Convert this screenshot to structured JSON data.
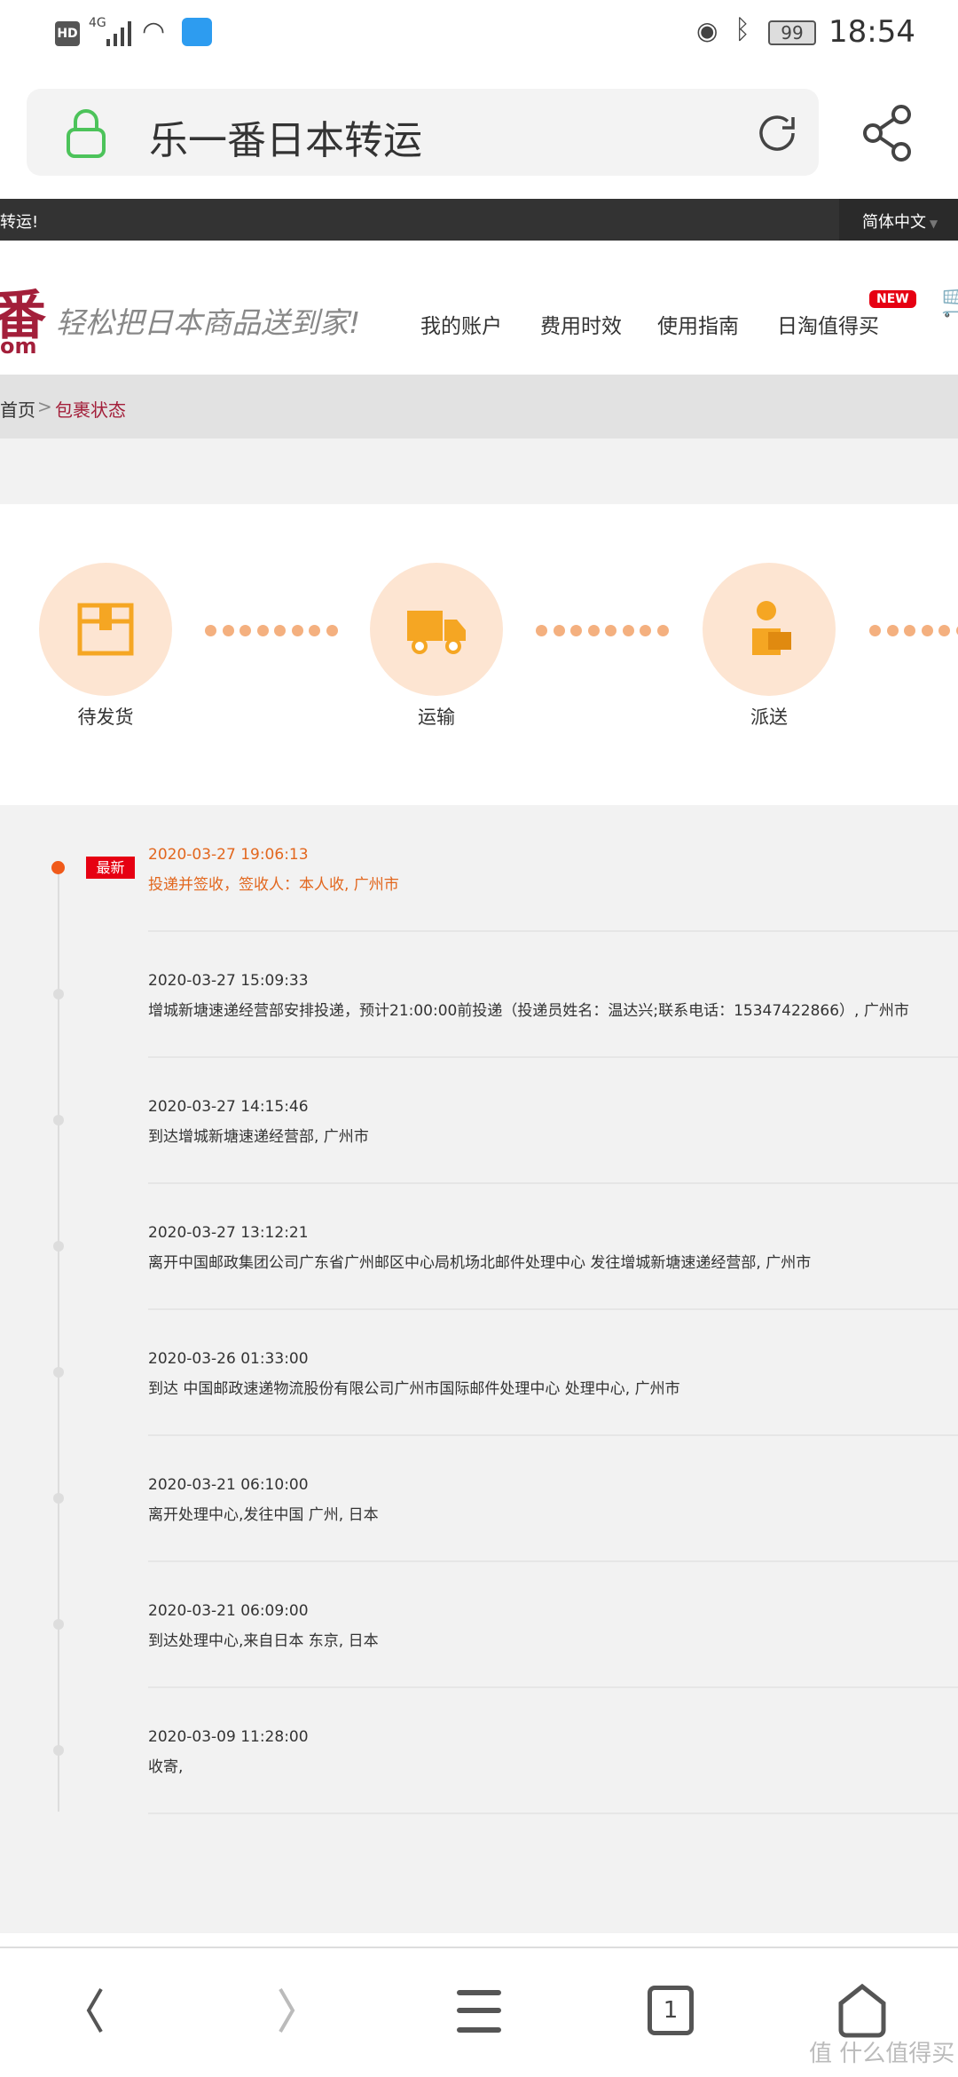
{
  "status_bar": {
    "hd": "HD",
    "network": "4G",
    "battery": "99",
    "time": "18:54"
  },
  "browser": {
    "title": "乐一番日本转运"
  },
  "top_bar": {
    "left_text": "转运!",
    "language": "简体中文"
  },
  "header": {
    "logo_char": "番",
    "logo_suffix": "om",
    "tagline": "轻松把日本商品送到家!",
    "nav": [
      {
        "label": "我的账户"
      },
      {
        "label": "费用时效"
      },
      {
        "label": "使用指南"
      },
      {
        "label": "日淘值得买"
      }
    ],
    "new_badge": "NEW"
  },
  "breadcrumb": {
    "home": "首页",
    "sep": ">",
    "current": "包裹状态"
  },
  "steps": [
    {
      "label": "待发货",
      "icon": "box-icon"
    },
    {
      "label": "运输",
      "icon": "truck-icon"
    },
    {
      "label": "派送",
      "icon": "courier-icon"
    }
  ],
  "colors": {
    "accent": "#e2671e",
    "badge": "#e60012",
    "step_bg": "#fde5d2",
    "step_icon": "#f5a623",
    "brand": "#a31f3a"
  },
  "timeline": {
    "latest_badge": "最新",
    "events": [
      {
        "time": "2020-03-27 19:06:13",
        "desc": "投递并签收，签收人：本人收, 广州市"
      },
      {
        "time": "2020-03-27 15:09:33",
        "desc": "增城新塘速递经营部安排投递，预计21:00:00前投递（投递员姓名：温达兴;联系电话：15347422866）, 广州市"
      },
      {
        "time": "2020-03-27 14:15:46",
        "desc": "到达增城新塘速递经营部, 广州市"
      },
      {
        "time": "2020-03-27 13:12:21",
        "desc": "离开中国邮政集团公司广东省广州邮区中心局机场北邮件处理中心 发往增城新塘速递经营部, 广州市"
      },
      {
        "time": "2020-03-26 01:33:00",
        "desc": "到达 中国邮政速递物流股份有限公司广州市国际邮件处理中心 处理中心, 广州市"
      },
      {
        "time": "2020-03-21 06:10:00",
        "desc": "离开处理中心,发往中国 广州, 日本"
      },
      {
        "time": "2020-03-21 06:09:00",
        "desc": "到达处理中心,来自日本 东京, 日本"
      },
      {
        "time": "2020-03-09 11:28:00",
        "desc": "收寄,"
      }
    ]
  },
  "bottom_nav": {
    "tabs_count": "1",
    "watermark": "值 什么值得买"
  }
}
